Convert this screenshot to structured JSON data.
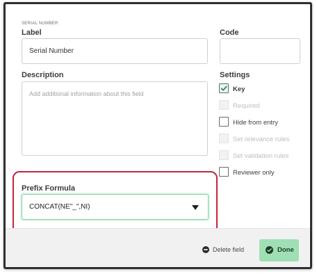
{
  "section": {
    "title": "SERIAL NUMBER"
  },
  "label_field": {
    "label": "Label",
    "value": "Serial Number"
  },
  "code_field": {
    "label": "Code",
    "value": ""
  },
  "description_field": {
    "label": "Description",
    "placeholder": "Add additional information about this field"
  },
  "settings": {
    "title": "Settings",
    "items": [
      {
        "label": "Key",
        "checked": true,
        "disabled": false
      },
      {
        "label": "Required",
        "checked": false,
        "disabled": true
      },
      {
        "label": "Hide from entry",
        "checked": false,
        "disabled": false
      },
      {
        "label": "Set relevance rules",
        "checked": false,
        "disabled": true
      },
      {
        "label": "Set validation rules",
        "checked": false,
        "disabled": true
      },
      {
        "label": "Reviewer only",
        "checked": false,
        "disabled": false
      }
    ]
  },
  "prefix_formula": {
    "label": "Prefix Formula",
    "value": "CONCAT(NE\"_\",NI)"
  },
  "footer": {
    "delete_label": "Delete field",
    "done_label": "Done"
  },
  "colors": {
    "accent_green": "#9ee0b4",
    "highlight_red": "#c4243a",
    "focus_green": "#7bd39e"
  },
  "icons": {
    "checkbox_checked": "checkmark-icon",
    "dropdown": "caret-down-icon",
    "delete": "minus-circle-icon",
    "done": "check-circle-icon"
  }
}
